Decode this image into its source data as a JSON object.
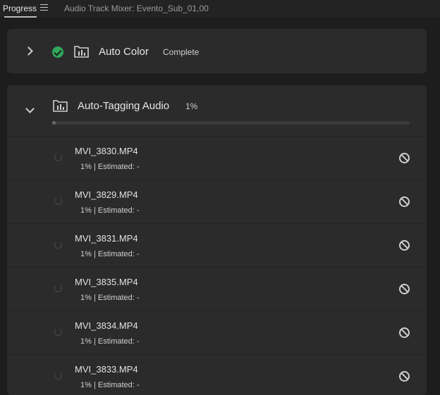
{
  "tabs": {
    "active": "Progress",
    "inactive": "Audio Track Mixer: Evento_Sub_01,00"
  },
  "jobs": [
    {
      "title": "Auto Color",
      "status": "Complete",
      "expanded": false,
      "state": "complete"
    },
    {
      "title": "Auto-Tagging Audio",
      "status": "1%",
      "expanded": true,
      "progress": 0.01
    }
  ],
  "items": [
    {
      "name": "MVI_3830.MP4",
      "sub": "1% | Estimated: -"
    },
    {
      "name": "MVI_3829.MP4",
      "sub": "1% | Estimated: -"
    },
    {
      "name": "MVI_3831.MP4",
      "sub": "1% | Estimated: -"
    },
    {
      "name": "MVI_3835.MP4",
      "sub": "1% | Estimated: -"
    },
    {
      "name": "MVI_3834.MP4",
      "sub": "1% | Estimated: -"
    },
    {
      "name": "MVI_3833.MP4",
      "sub": "1% | Estimated: -"
    }
  ],
  "icons": {
    "tab_menu": "hamburger-icon",
    "collapse": "chevron-right-icon",
    "expand": "chevron-down-icon",
    "complete": "check-circle-icon",
    "job": "bin-chart-icon",
    "pending": "spinner-icon",
    "cancel": "cancel-icon"
  },
  "colors": {
    "background": "#1d1d1d",
    "panel": "#2b2b2b",
    "success": "#2fa85a"
  }
}
